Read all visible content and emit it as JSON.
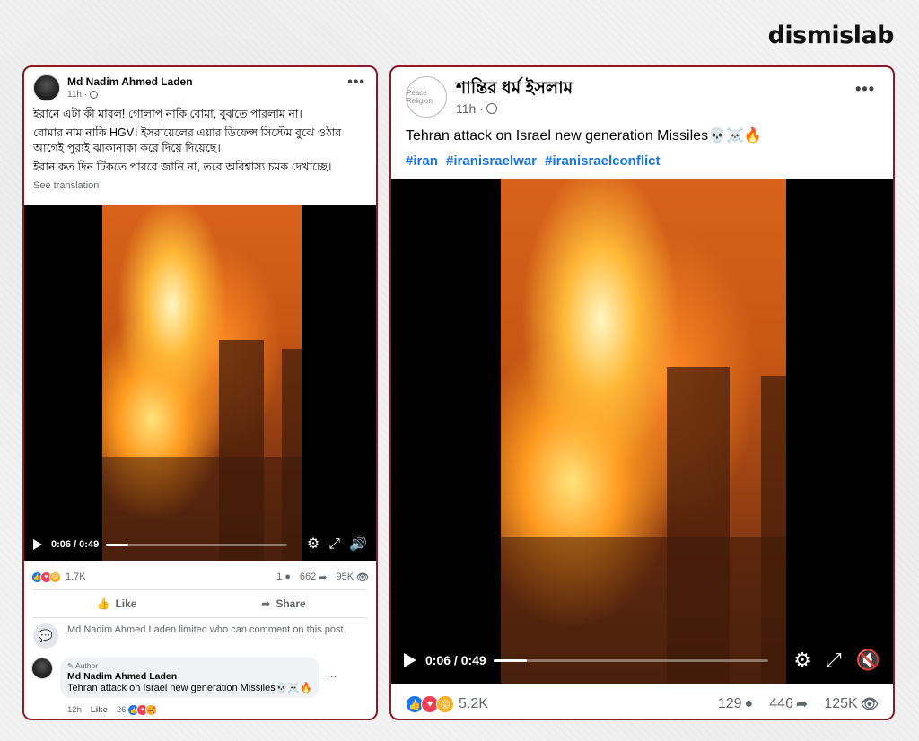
{
  "brand": {
    "logo": "dismislab"
  },
  "left_post": {
    "author": "Md Nadim Ahmed Laden",
    "time": "11h ·",
    "more_label": "•••",
    "text_lines": [
      "ইরানে এটা কী মারল! গোলাপ নাকি বোমা, বুঝতে পারলাম না।",
      "বোমার নাম নাকি HGV। ইসরায়েলের এয়ার ডিফেন্স সিস্টেম বুঝে ওঠার আগেই পুরাই ঝাকানাকা করে দিয়ে দিয়েছে।",
      "ইরান কত দিন টিকতে পারবে জানি না, তবে অবিশ্বাস্য চমক দেখাচ্ছে।"
    ],
    "see_translation": "See translation",
    "video": {
      "time": "0:06 / 0:49",
      "progress": 0.122
    },
    "stats": {
      "reactions_count": "1.7K",
      "comments": "1",
      "shares": "662",
      "views": "95K"
    },
    "actions": {
      "like": "Like",
      "share": "Share"
    },
    "limited_notice": "Md Nadim Ahmed Laden limited who can comment on this post.",
    "comment": {
      "badge": "Author",
      "author": "Md Nadim Ahmed Laden",
      "text": "Tehran attack on Israel new generation Missiles💀☠️🔥",
      "time": "12h",
      "like": "Like",
      "reactions_count": "26"
    }
  },
  "right_post": {
    "author": "শান্তির ধর্ম ইসলাম",
    "time": "11h ·",
    "more_label": "•••",
    "avatar_text": "Peace Religion",
    "text": "Tehran attack on Israel new generation  Missiles💀☠️🔥",
    "hashtags": [
      "#iran",
      "#iranisraelwar",
      "#iranisraelconflict"
    ],
    "video": {
      "time": "0:06 / 0:49",
      "progress": 0.122
    },
    "stats": {
      "reactions_count": "5.2K",
      "comments": "129",
      "shares": "446",
      "views": "125K"
    }
  },
  "colors": {
    "border": "#8b1a2b",
    "link": "#1b74e4",
    "like": "#1877f2",
    "love": "#f33e58",
    "wow": "#f7b125"
  }
}
